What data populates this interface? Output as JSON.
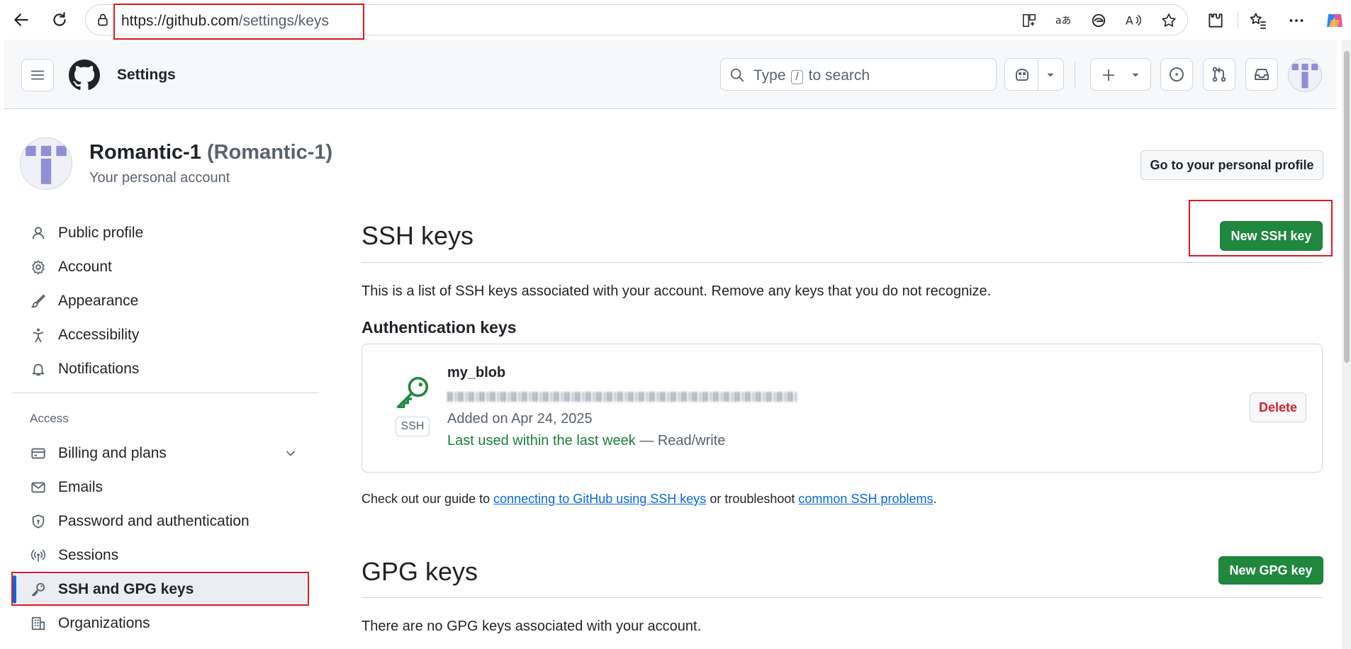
{
  "browser": {
    "url_host": "https://github.com",
    "url_path": "/settings/keys"
  },
  "header": {
    "title": "Settings",
    "search_prefix": "Type",
    "search_key": "/",
    "search_suffix": "to search"
  },
  "profile": {
    "name": "Romantic-1",
    "handle": "(Romantic-1)",
    "subtitle": "Your personal account",
    "profile_button": "Go to your personal profile"
  },
  "sidebar": {
    "items": [
      {
        "label": "Public profile",
        "icon": "person-icon"
      },
      {
        "label": "Account",
        "icon": "gear-icon"
      },
      {
        "label": "Appearance",
        "icon": "paintbrush-icon"
      },
      {
        "label": "Accessibility",
        "icon": "accessibility-icon"
      },
      {
        "label": "Notifications",
        "icon": "bell-icon"
      }
    ],
    "section_access": "Access",
    "access_items": [
      {
        "label": "Billing and plans",
        "icon": "credit-card-icon"
      },
      {
        "label": "Emails",
        "icon": "mail-icon"
      },
      {
        "label": "Password and authentication",
        "icon": "shield-icon"
      },
      {
        "label": "Sessions",
        "icon": "broadcast-icon"
      },
      {
        "label": "SSH and GPG keys",
        "icon": "key-icon"
      },
      {
        "label": "Organizations",
        "icon": "organization-icon"
      }
    ]
  },
  "ssh": {
    "title": "SSH keys",
    "new_button": "New SSH key",
    "description": "This is a list of SSH keys associated with your account. Remove any keys that you do not recognize.",
    "auth_heading": "Authentication keys",
    "key": {
      "name": "my_blob",
      "badge": "SSH",
      "added": "Added on Apr 24, 2025",
      "last_used": "Last used within the last week",
      "access": "— Read/write",
      "delete_label": "Delete"
    },
    "guide_prefix": "Check out our guide to",
    "guide_link": "connecting to GitHub using SSH keys",
    "guide_middle": "or troubleshoot",
    "problems_link": "common SSH problems",
    "guide_suffix": "."
  },
  "gpg": {
    "title": "GPG keys",
    "new_button": "New GPG key",
    "empty": "There are no GPG keys associated with your account."
  },
  "colors": {
    "primary_green": "#1f883d",
    "link_blue": "#0969da",
    "danger_red": "#cf222e",
    "highlight_red": "#e3161e",
    "avatar_purple": "#8f8fd6"
  }
}
